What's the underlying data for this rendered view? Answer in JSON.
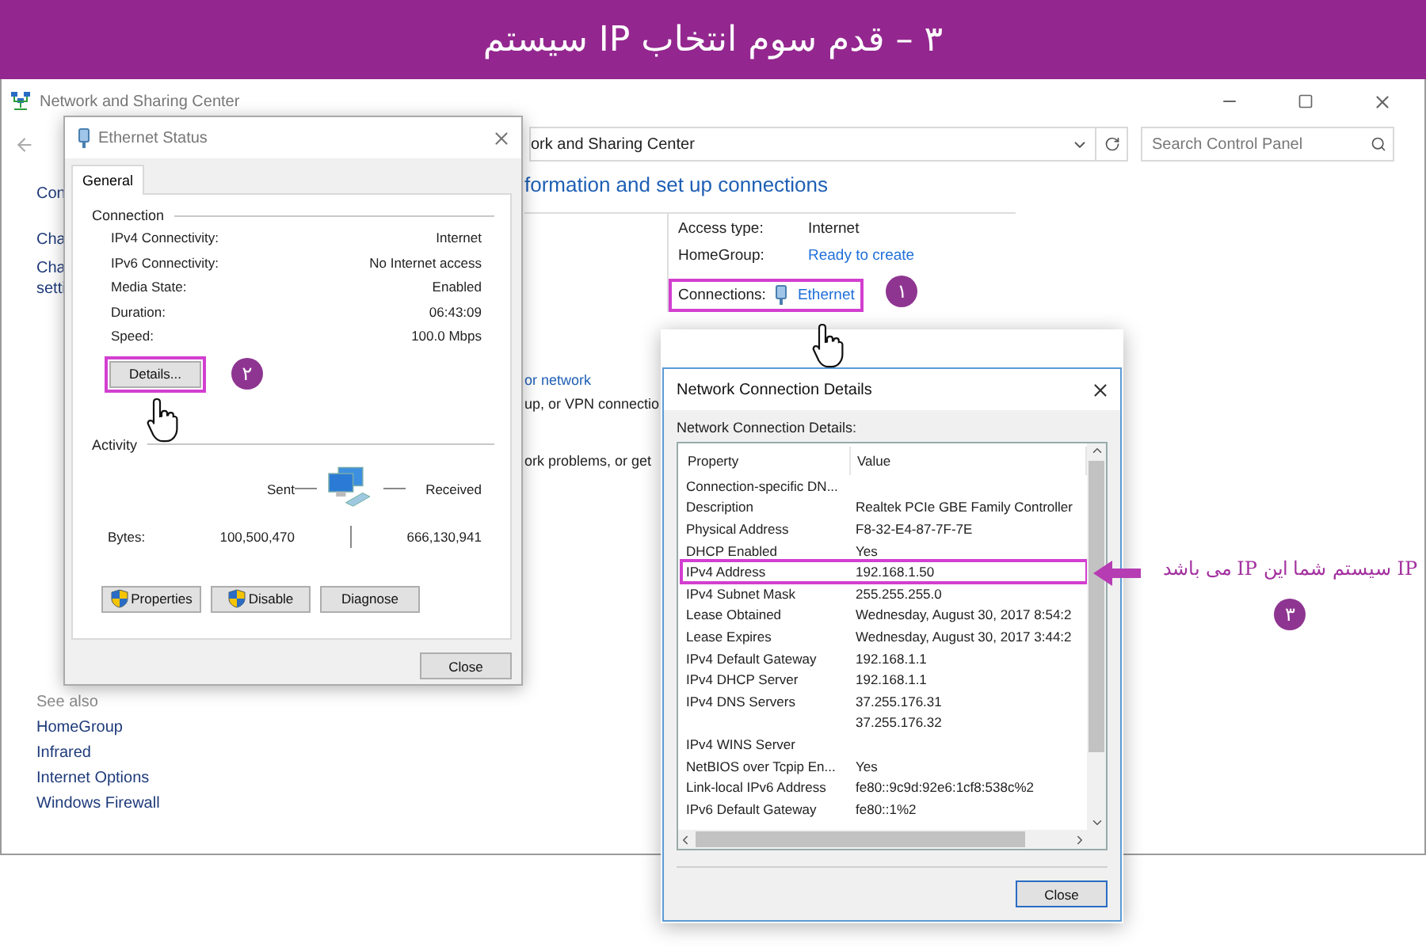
{
  "banner": {
    "title": "۳ – قدم سوم انتخاب IP سیستم"
  },
  "main_window": {
    "title": "Network and Sharing Center",
    "address": "ork and Sharing Center",
    "search": {
      "placeholder": "Search Control Panel"
    },
    "sidebar": {
      "home": "Con",
      "links": [
        "Cha",
        "Cha\nsetti"
      ]
    },
    "see_also": {
      "title": "See also",
      "links": [
        "HomeGroup",
        "Infrared",
        "Internet Options",
        "Windows Firewall"
      ]
    },
    "heading": "formation and set up connections",
    "network_info": [
      {
        "label": "Access type:",
        "value": "Internet",
        "kind": "text",
        "highlighted": false
      },
      {
        "label": "HomeGroup:",
        "value": "Ready to create",
        "kind": "link",
        "highlighted": false
      },
      {
        "label": "Connections:",
        "value": "Ethernet",
        "kind": "connection",
        "highlighted": true,
        "step": "١"
      }
    ],
    "tasks": [
      {
        "link": "or network",
        "description": "up, or VPN connectio"
      },
      {
        "description": "ork problems, or get"
      }
    ]
  },
  "ethernet_status": {
    "title": "Ethernet Status",
    "tabs": [
      {
        "label": "General",
        "selected": true
      }
    ],
    "connection_title": "Connection",
    "rows": [
      {
        "label": "IPv4 Connectivity:",
        "value": "Internet"
      },
      {
        "label": "IPv6 Connectivity:",
        "value": "No Internet access"
      },
      {
        "label": "Media State:",
        "value": "Enabled"
      },
      {
        "label": "Duration:",
        "value": "06:43:09"
      },
      {
        "label": "Speed:",
        "value": "100.0 Mbps"
      }
    ],
    "details_button": {
      "label": "Details...",
      "highlighted": true,
      "step": "٢"
    },
    "activity_title": "Activity",
    "sent": "Sent",
    "received": "Received",
    "bytes_label": "Bytes:",
    "bytes_sent": "100,500,470",
    "bytes_received": "666,130,941",
    "buttons": [
      {
        "label": "Properties",
        "shield": true
      },
      {
        "label": "Disable",
        "shield": true
      },
      {
        "label": "Diagnose",
        "shield": false
      }
    ],
    "close": "Close"
  },
  "details": {
    "title": "Network Connection Details",
    "list_label": "Network Connection Details:",
    "columns": [
      "Property",
      "Value"
    ],
    "rows": [
      {
        "property": "Connection-specific DN...",
        "highlighted": false
      },
      {
        "property": "Description",
        "value": "Realtek PCIe GBE Family Controller",
        "highlighted": false
      },
      {
        "property": "Physical Address",
        "value": "F8-32-E4-87-7F-7E",
        "highlighted": false
      },
      {
        "property": "DHCP Enabled",
        "value": "Yes",
        "highlighted": false
      },
      {
        "property": "IPv4 Address",
        "value": "192.168.1.50",
        "highlighted": true
      },
      {
        "property": "IPv4 Subnet Mask",
        "value": "255.255.255.0",
        "highlighted": false
      },
      {
        "property": "Lease Obtained",
        "value": "Wednesday, August 30, 2017 8:54:2",
        "highlighted": false
      },
      {
        "property": "Lease Expires",
        "value": "Wednesday, August 30, 2017 3:44:2",
        "highlighted": false
      },
      {
        "property": "IPv4 Default Gateway",
        "value": "192.168.1.1",
        "highlighted": false
      },
      {
        "property": "IPv4 DHCP Server",
        "value": "192.168.1.1",
        "highlighted": false
      },
      {
        "property": "IPv4 DNS Servers",
        "value": "37.255.176.31",
        "highlighted": false
      },
      {
        "value": "37.255.176.32",
        "highlighted": false
      },
      {
        "property": "IPv4 WINS Server",
        "highlighted": false
      },
      {
        "property": "NetBIOS over Tcpip En...",
        "value": "Yes",
        "highlighted": false
      },
      {
        "property": "Link-local IPv6 Address",
        "value": "fe80::9c9d:92e6:1cf8:538c%2",
        "highlighted": false
      },
      {
        "property": "IPv6 Default Gateway",
        "value": "fe80::1%2",
        "highlighted": false
      }
    ],
    "close": "Close"
  },
  "annotation": {
    "text": "IP سیستم شما این IP می باشد",
    "step": "۳"
  }
}
